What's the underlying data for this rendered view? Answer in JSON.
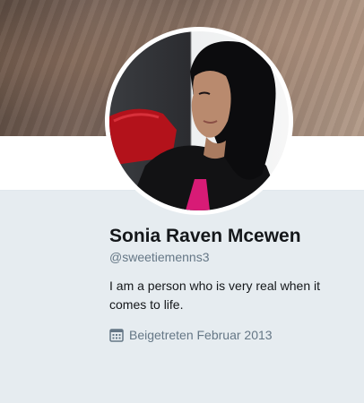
{
  "profile": {
    "name": "Sonia Raven Mcewen",
    "handle": "@sweetiemenns3",
    "bio": "I am a person who is very real when it comes to life.",
    "joined": "Beigetreten Februar 2013"
  },
  "icons": {
    "joined": "calendar-icon"
  },
  "colors": {
    "background": "#e6ecf0",
    "text_primary": "#14171a",
    "text_secondary": "#657786"
  }
}
